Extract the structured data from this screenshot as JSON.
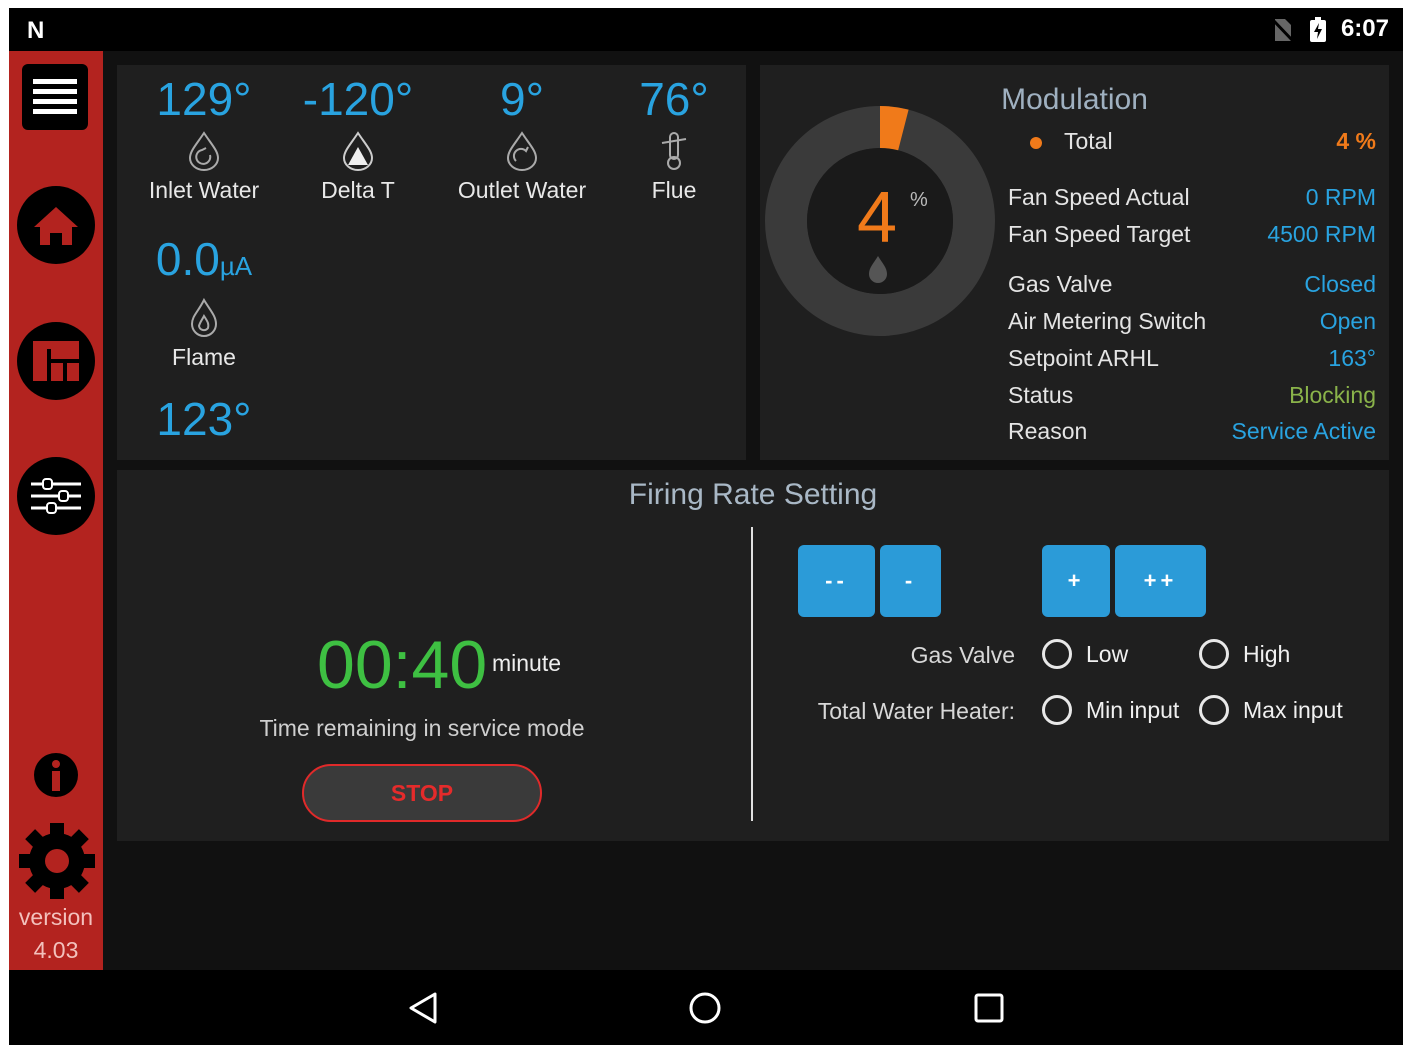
{
  "status_bar": {
    "logo": "N",
    "time": "6:07"
  },
  "sidebar": {
    "version_label": "version",
    "version_number": "4.03"
  },
  "temps": [
    {
      "value": "129°",
      "label": "Inlet Water"
    },
    {
      "value": "-120°",
      "label": "Delta T"
    },
    {
      "value": "9°",
      "label": "Outlet Water"
    },
    {
      "value": "76°",
      "label": "Flue"
    }
  ],
  "flame": {
    "value": "0.0",
    "unit": "µA",
    "label": "Flame"
  },
  "extra_temp": "123°",
  "modulation": {
    "title": "Modulation",
    "gauge_value": "4",
    "gauge_unit": "%",
    "gauge_fraction": 0.04,
    "total_label": "Total",
    "total_value": "4 %",
    "rows": [
      {
        "key": "Fan Speed Actual",
        "value": "0 RPM"
      },
      {
        "key": "Fan Speed Target",
        "value": "4500 RPM"
      },
      {
        "key": "Gas Valve",
        "value": "Closed"
      },
      {
        "key": "Air Metering Switch",
        "value": "Open"
      },
      {
        "key": "Setpoint ARHL",
        "value": "163°"
      },
      {
        "key": "Status",
        "value": "Blocking"
      },
      {
        "key": "Reason",
        "value": "Service Active"
      }
    ]
  },
  "firing": {
    "title": "Firing Rate Setting",
    "timer": "00:40",
    "timer_unit": "minute",
    "timer_label": "Time remaining in service mode",
    "stop_label": "STOP",
    "buttons": {
      "dec_big": "--",
      "dec": "-",
      "inc": "+",
      "inc_big": "++"
    },
    "gas_valve_label": "Gas Valve",
    "gas_low": "Low",
    "gas_high": "High",
    "heater_label": "Total Water Heater:",
    "heater_min": "Min input",
    "heater_max": "Max input"
  },
  "colors": {
    "accent_blue": "#29a3e0",
    "sidebar_red": "#b3231f",
    "orange": "#f07a1a",
    "green": "#3ec042",
    "olive": "#8ab34a"
  }
}
